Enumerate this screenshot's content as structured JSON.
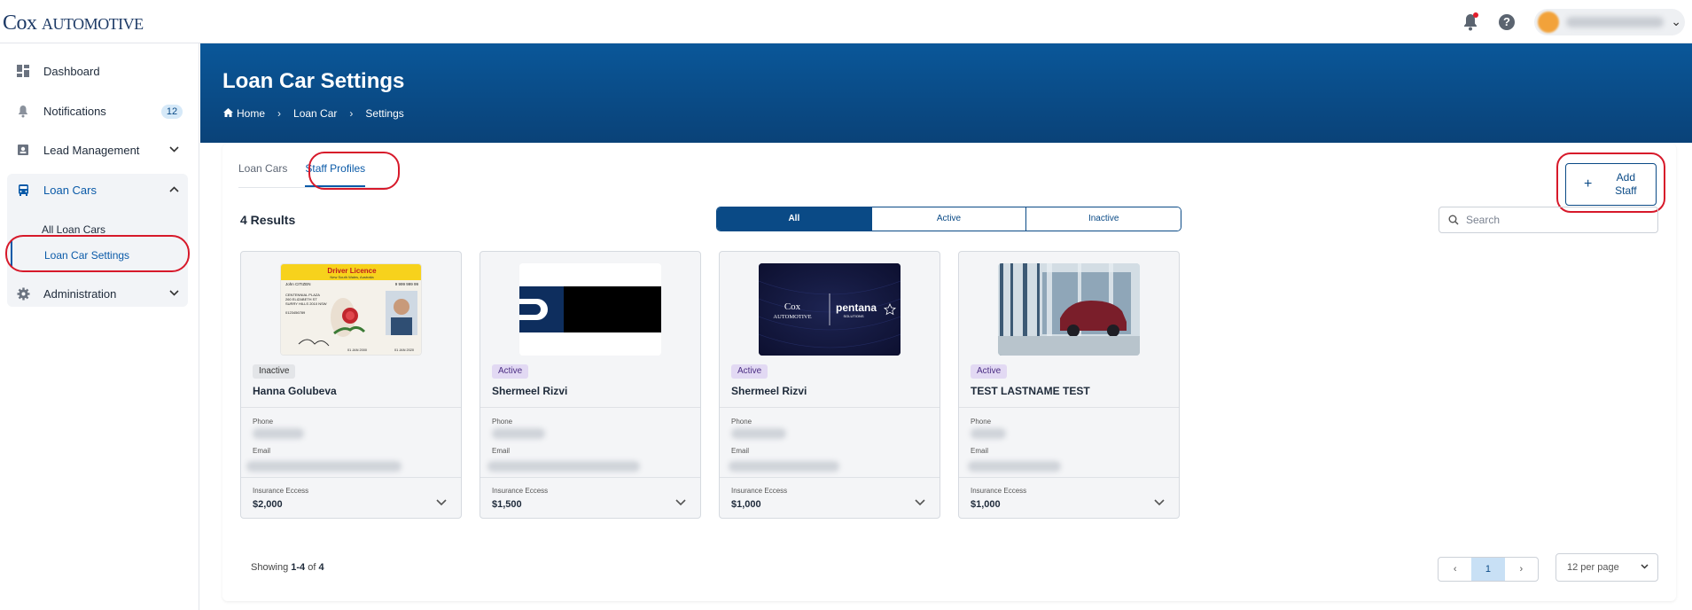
{
  "app": {
    "logo_main": "Cox",
    "logo_small": "Automotive"
  },
  "colors": {
    "primary": "#0a4a86",
    "accent": "#0a5aa8",
    "annotation": "#d7192a"
  },
  "topbar": {
    "icons": [
      "bell-icon",
      "help-icon"
    ],
    "help_glyph": "?"
  },
  "sidebar": {
    "items": [
      {
        "label": "Dashboard",
        "icon": "dashboard-icon"
      },
      {
        "label": "Notifications",
        "icon": "bell-icon",
        "badge": "12"
      },
      {
        "label": "Lead Management",
        "icon": "lead-icon"
      },
      {
        "label": "Loan Cars",
        "icon": "car-icon"
      },
      {
        "label": "Administration",
        "icon": "gear-icon"
      }
    ],
    "subitems": [
      {
        "label": "All Loan Cars"
      },
      {
        "label": "Loan Car Settings"
      }
    ]
  },
  "header": {
    "title": "Loan Car Settings",
    "breadcrumb": [
      "Home",
      "Loan Car",
      "Settings"
    ]
  },
  "tabs": [
    "Loan Cars",
    "Staff Profiles"
  ],
  "results_label": "4 Results",
  "filters": [
    "All",
    "Active",
    "Inactive"
  ],
  "add_staff": {
    "plus": "+",
    "label": "Add Staff"
  },
  "search": {
    "placeholder": "Search"
  },
  "cards": [
    {
      "status": "Inactive",
      "name": "Hanna Golubeva",
      "phone_label": "Phone",
      "email_label": "Email",
      "excess_label": "Insurance Eccess",
      "excess": "$2,000",
      "licence": {
        "title": "Driver Licence",
        "sub": "New South Wales, Australia",
        "name": "John CITIZEN",
        "number": "9 999 999 99",
        "addr1": "CENTENNIAL PLAZA",
        "addr2": "260 ELIZABETH ST",
        "addr3": "SURRY HILLS 2010 NSW",
        "no": "0123456789",
        "date1": "01 JAN 2000",
        "date2": "01 JAN 2020"
      }
    },
    {
      "status": "Active",
      "name": "Shermeel Rizvi",
      "phone_label": "Phone",
      "email_label": "Email",
      "excess_label": "Insurance Eccess",
      "excess": "$1,500"
    },
    {
      "status": "Active",
      "name": "Shermeel Rizvi",
      "phone_label": "Phone",
      "email_label": "Email",
      "excess_label": "Insurance Eccess",
      "excess": "$1,000",
      "brand": {
        "left1": "Cox",
        "left2": "Automotive",
        "right": "pentana",
        "right_sub": "SOLUTIONS"
      }
    },
    {
      "status": "Active",
      "name": "TEST LASTNAME TEST",
      "phone_label": "Phone",
      "email_label": "Email",
      "excess_label": "Insurance Eccess",
      "excess": "$1,000"
    }
  ],
  "footer": {
    "showing_prefix": "Showing ",
    "showing_range": "1-4",
    "showing_of": " of ",
    "showing_total": "4",
    "prev": "‹",
    "page": "1",
    "next": "›",
    "per_page": "12 per page"
  }
}
